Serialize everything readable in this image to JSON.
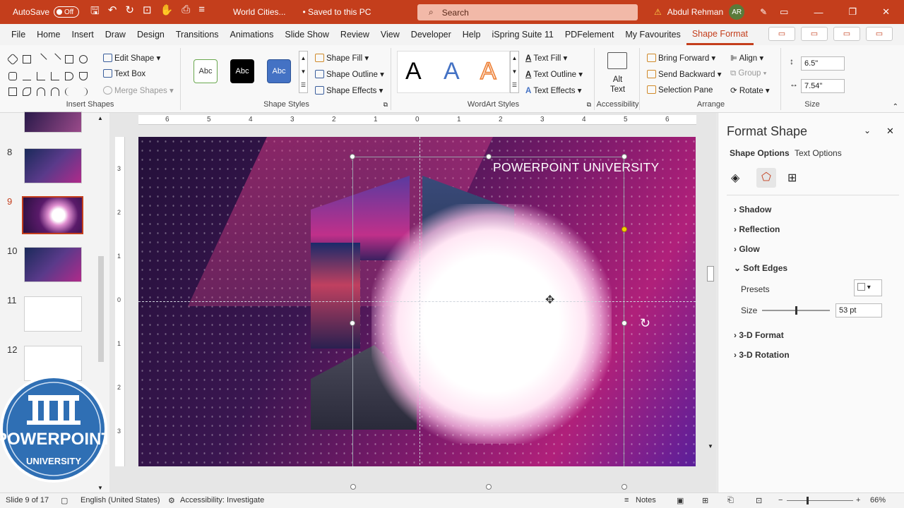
{
  "titlebar": {
    "autosave_label": "AutoSave",
    "autosave_state": "Off",
    "doc_title": "World Cities...",
    "saved_status": "• Saved to this PC",
    "search_placeholder": "Search",
    "user_name": "Abdul Rehman",
    "user_initials": "AR"
  },
  "tabs": [
    "File",
    "Home",
    "Insert",
    "Draw",
    "Design",
    "Transitions",
    "Animations",
    "Slide Show",
    "Review",
    "View",
    "Developer",
    "Help",
    "iSpring Suite 11",
    "PDFelement",
    "My Favourites",
    "Shape Format"
  ],
  "active_tab": "Shape Format",
  "ribbon": {
    "insert_shapes": {
      "label": "Insert Shapes",
      "edit_shape": "Edit Shape",
      "text_box": "Text Box",
      "merge_shapes": "Merge Shapes"
    },
    "shape_styles": {
      "label": "Shape Styles",
      "style1": "Abc",
      "style2": "Abc",
      "style3": "Abc",
      "shape_fill": "Shape Fill",
      "shape_outline": "Shape Outline",
      "shape_effects": "Shape Effects"
    },
    "wordart_styles": {
      "label": "WordArt Styles",
      "letter1": "A",
      "letter2": "A",
      "letter3": "A",
      "text_fill": "Text Fill",
      "text_outline": "Text Outline",
      "text_effects": "Text Effects"
    },
    "accessibility": {
      "label": "Accessibility",
      "alt_text_1": "Alt",
      "alt_text_2": "Text"
    },
    "arrange": {
      "label": "Arrange",
      "bring_forward": "Bring Forward",
      "send_backward": "Send Backward",
      "selection_pane": "Selection Pane",
      "align": "Align",
      "group": "Group",
      "rotate": "Rotate"
    },
    "size": {
      "label": "Size",
      "height": "6.5\"",
      "width": "7.54\""
    }
  },
  "thumbnails": {
    "numbers": [
      "8",
      "9",
      "10",
      "11",
      "12"
    ],
    "selected": "9"
  },
  "ruler": {
    "h_ticks": [
      "6",
      "5",
      "4",
      "3",
      "2",
      "1",
      "0",
      "1",
      "2",
      "3",
      "4",
      "5",
      "6"
    ],
    "v_ticks": [
      "3",
      "2",
      "1",
      "0",
      "1",
      "2",
      "3"
    ]
  },
  "slide": {
    "title": "POWERPOINT UNIVERSITY"
  },
  "logo": {
    "line1": "POWERPOINT",
    "line2": "UNIVERSITY"
  },
  "format_pane": {
    "title": "Format Shape",
    "tab_shape_options": "Shape Options",
    "tab_text_options": "Text Options",
    "sections": [
      "Shadow",
      "Reflection",
      "Glow",
      "Soft Edges",
      "3-D Format",
      "3-D Rotation"
    ],
    "presets_label": "Presets",
    "size_label": "Size",
    "size_value": "53 pt",
    "slider_value_fraction": 0.5
  },
  "status": {
    "slide_info": "Slide 9 of 17",
    "language": "English (United States)",
    "accessibility": "Accessibility: Investigate",
    "notes": "Notes",
    "zoom": "66%"
  },
  "colors": {
    "accent": "#c43e1c",
    "selection": "#c43e1c"
  }
}
